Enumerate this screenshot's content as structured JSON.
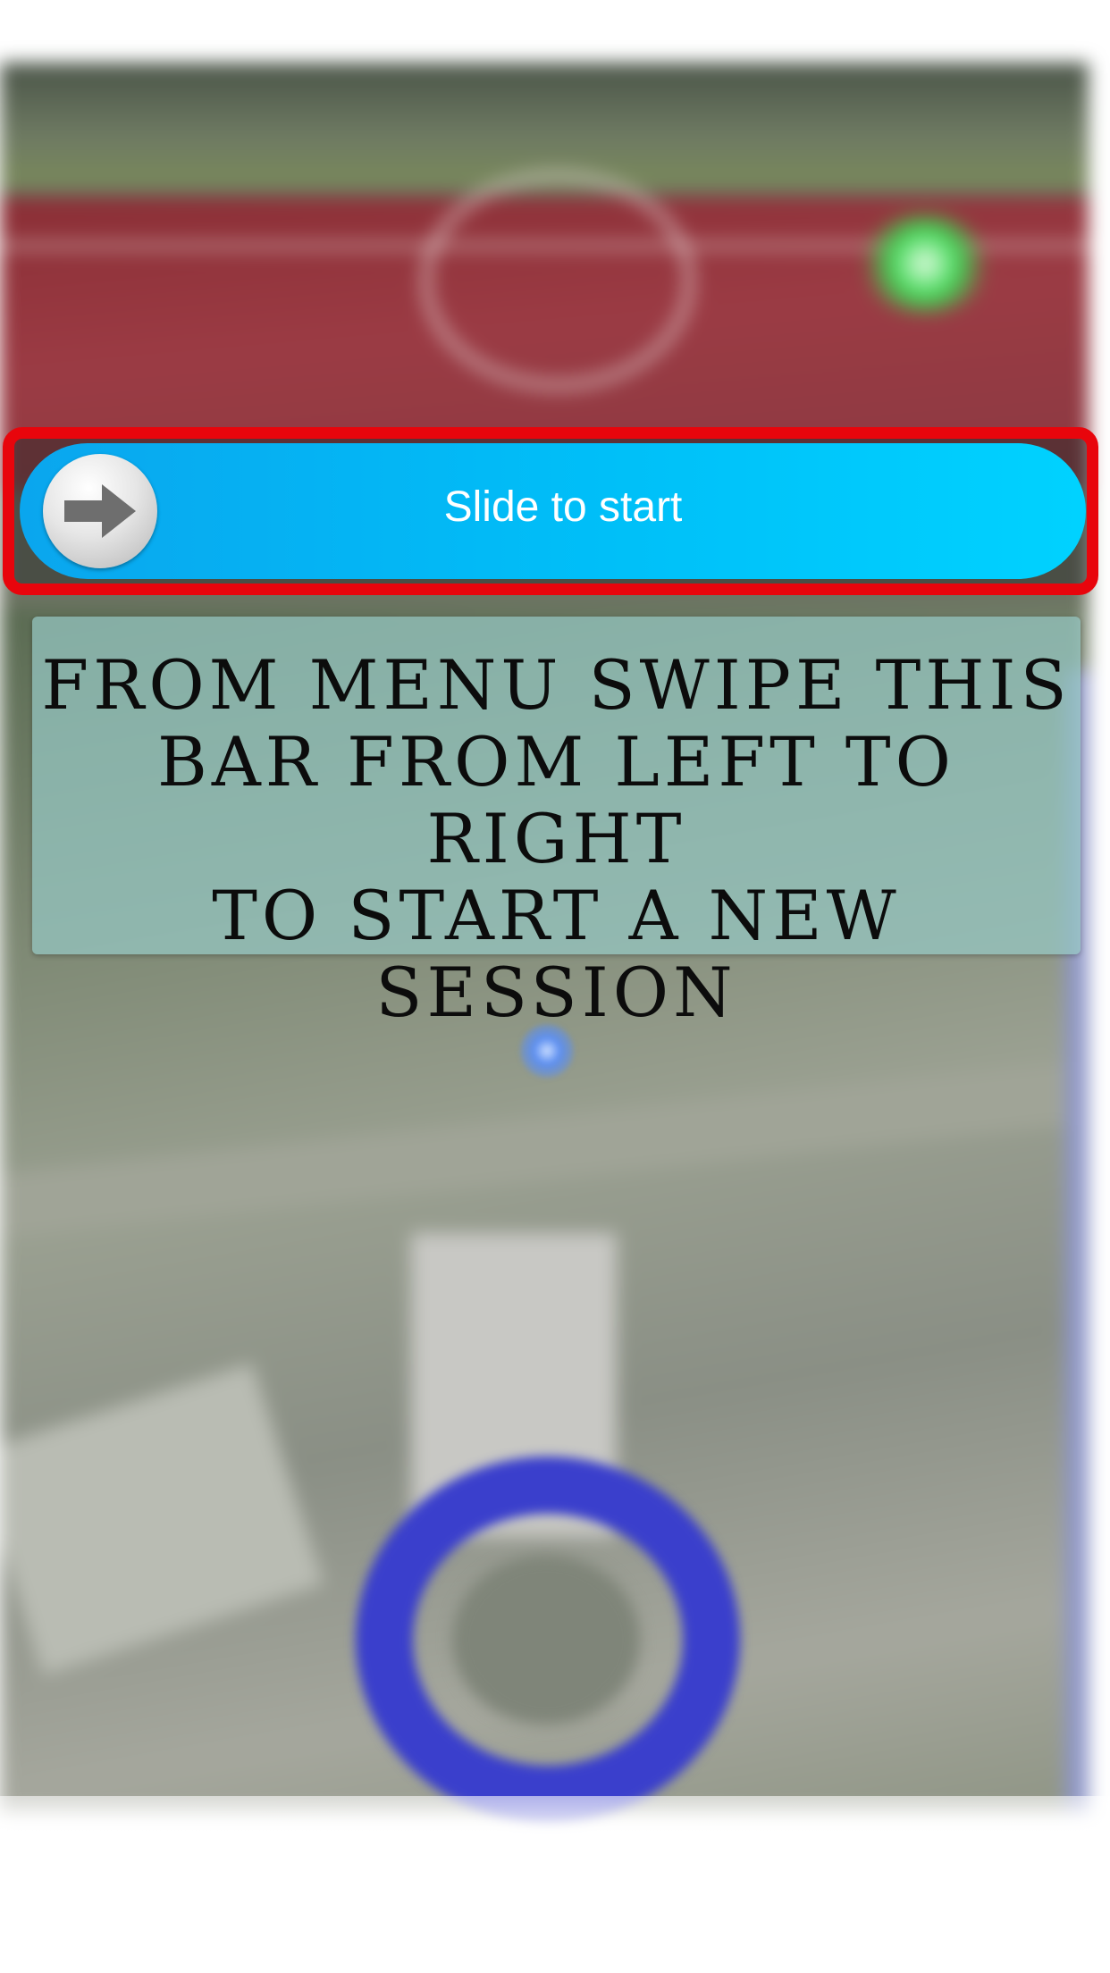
{
  "slider": {
    "label": "Slide to start",
    "knob_icon": "arrow-right-icon",
    "bar_color": "#00bff8",
    "highlight_color": "#e8050c"
  },
  "instruction": {
    "lines": [
      "FROM MENU SWIPE THIS",
      "BAR FROM LEFT TO RIGHT",
      "TO START A NEW SESSION"
    ]
  },
  "background": {
    "compass_ring_color": "#3a3fcc",
    "compass_label": "",
    "location_marker_icon": "location-dot-icon"
  }
}
